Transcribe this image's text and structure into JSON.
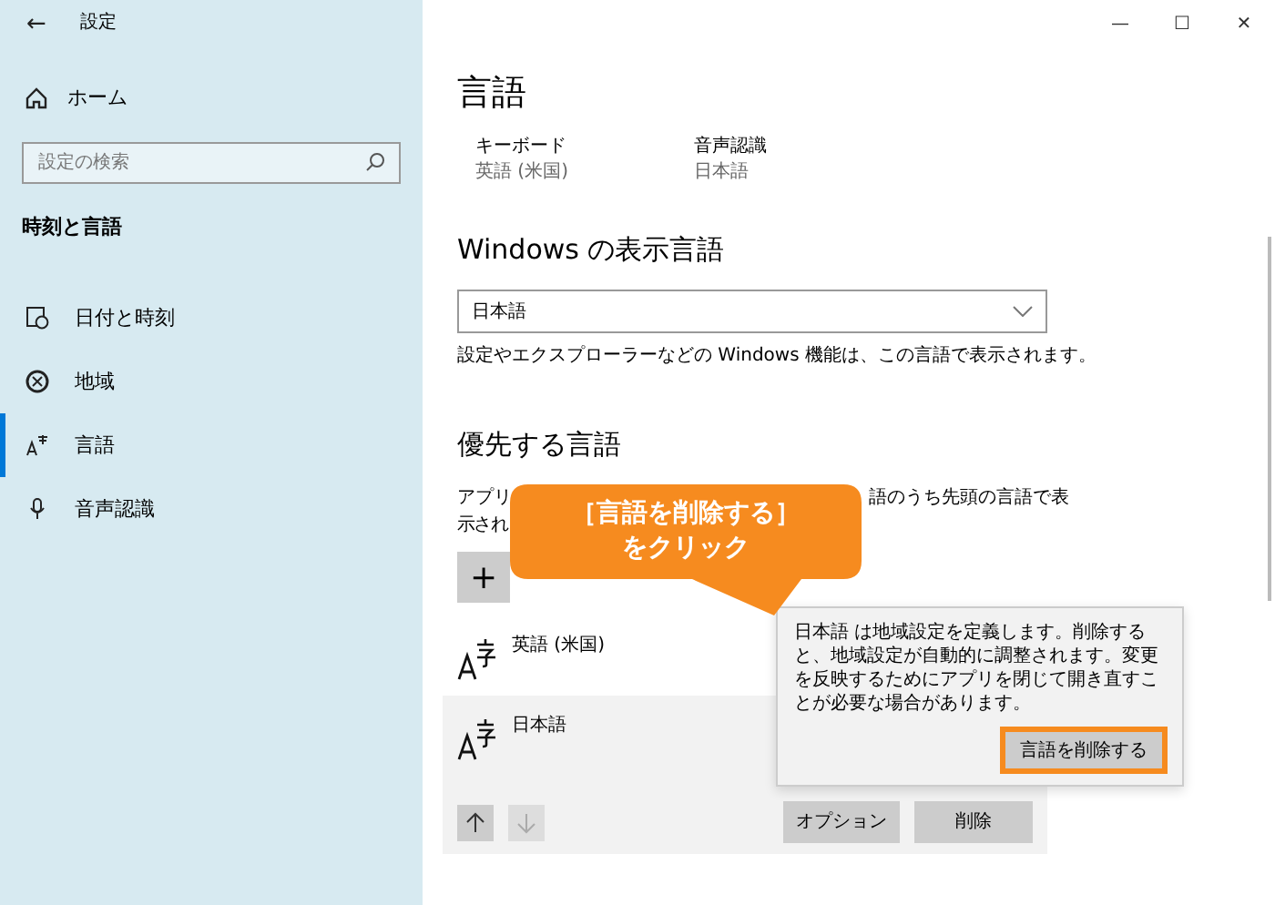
{
  "window": {
    "title": "設定",
    "back_glyph": "←",
    "controls": [
      "—",
      "☐",
      "✕"
    ]
  },
  "sidebar": {
    "home": "ホーム",
    "search": {
      "placeholder": "設定の検索"
    },
    "section": "時刻と言語",
    "items": [
      {
        "label": "日付と時刻",
        "kind": "clock",
        "selected": false
      },
      {
        "label": "地域",
        "kind": "globe",
        "selected": false
      },
      {
        "label": "言語",
        "kind": "language",
        "selected": true
      },
      {
        "label": "音声認識",
        "kind": "mic",
        "selected": false
      }
    ]
  },
  "page": {
    "title": "言語",
    "summary": [
      {
        "label": "キーボード",
        "value": "英語 (米国)"
      },
      {
        "label": "音声認識",
        "value": "日本語"
      }
    ],
    "display_language": {
      "heading": "Windows の表示言語",
      "value": "日本語",
      "note": "設定やエクスプローラーなどの Windows 機能は、この言語で表示されます。"
    },
    "preferred": {
      "heading": "優先する言語",
      "text_fragments": [
        "アプリ",
        "語のうち先頭の言語で表",
        "示され"
      ],
      "add_glyph": "+",
      "languages": [
        {
          "name": "英語 (米国)",
          "selected": false
        },
        {
          "name": "日本語",
          "selected": true
        }
      ],
      "up_enabled": true,
      "down_enabled": false,
      "buttons": [
        "オプション",
        "削除"
      ]
    }
  },
  "popup": {
    "text": "日本語 は地域設定を定義します。削除すると、地域設定が自動的に調整されます。変更を反映するためにアプリを閉じて開き直すことが必要な場合があります。",
    "button": "言語を削除する",
    "highlighted": true
  },
  "callout": {
    "lines": [
      "［言語を削除する］",
      "をクリック"
    ]
  }
}
